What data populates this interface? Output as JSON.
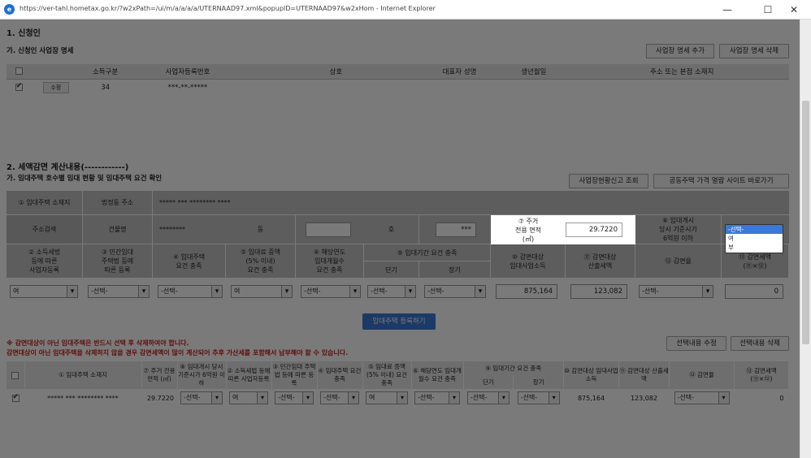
{
  "window": {
    "url": "https://ver-tahl.hometax.go.kr/?w2xPath=/ui/m/a/a/a/a/UTERNAAD97.xml&popupID=UTERNAAD97&w2xHom - Internet Explorer",
    "minimize": "—",
    "maximize": "☐",
    "close": "✕"
  },
  "section1": {
    "title": "1. 신청인",
    "subtitle": "가. 신청인 사업장 명세",
    "add_btn": "사업장 명세 추가",
    "del_btn": "사업장 명세 삭제",
    "columns": [
      "소득구분",
      "사업자등록번호",
      "상호",
      "대표자 성명",
      "생년월일",
      "주소 또는 본점 소재지"
    ],
    "row": {
      "btn": "수정",
      "income": "34",
      "bizno": "***-**-*****"
    }
  },
  "section2": {
    "title": "2. 세액감면 계산내용(------------)",
    "subtitle": "가. 임대주택 호수별 임대 현황 및 임대주택 요건 확인",
    "btn_status": "사업장현황신고 조회",
    "btn_price": "공동주택 가격 열람 사이트 바로가기",
    "grid": {
      "loc_label": "① 임대주택 소재지",
      "legal_dong_label": "법정동 주소",
      "legal_dong_value": "*****  ***  ********  ****",
      "addr_search": "주소검색",
      "bldg_label": "건물명",
      "bldg_value": "********",
      "dong_label": "동",
      "ho_label": "호",
      "ho_value": "***",
      "area_label": [
        "⑦ 주거",
        "전용 면적",
        "(㎡)"
      ],
      "area_value": "29.7220",
      "start_price_label": [
        "⑧ 임대개시",
        "당시 기준시가",
        "6억원 이하"
      ],
      "dropdown_options": [
        "-선택-",
        "여",
        "부"
      ],
      "col_labels": [
        [
          "② 소득세법",
          "등에 따른",
          "사업자등록"
        ],
        [
          "③ 민간임대",
          "주택법 등에",
          "따른 등록"
        ],
        [
          "④ 임대주택",
          "요건 충족"
        ],
        [
          "⑤ 임대료 증액",
          "(5% 이내)",
          "요건 충족"
        ],
        [
          "⑥ 해당연도",
          "임대개월수",
          "요건 충족"
        ],
        [
          "⑨ 임대기간 요건 충족"
        ],
        [
          "⑩ 감면대상",
          "임대사업소득"
        ],
        [
          "⑪ 감면대상",
          "산출세액"
        ],
        [
          "⑫ 감면율"
        ],
        [
          "⑬ 감면세액",
          "(⑪×⑫)"
        ]
      ],
      "short_label": "단기",
      "long_label": "장기",
      "values": {
        "c2": "여",
        "c3": "-선택-",
        "c4": "-선택-",
        "c5": "여",
        "c6": "-선택-",
        "short": "-선택-",
        "long": "-선택-",
        "income": "875,164",
        "tax": "123,082",
        "rate": "-선택-",
        "reduce": "0"
      }
    },
    "register_btn": "임대주택 등록하기",
    "warn1": "※ 감면대상이 아닌 임대주택은 반드시 선택 후 삭제하여야 합니다.",
    "warn2": "  감면대상이 아닌 임대주택을 삭제하지 않을 경우 감면세액이 많이 계산되어 추후 가산세를 포함해서 납부해야 할 수 있습니다.",
    "btn_edit": "선택내용 수정",
    "btn_delete": "선택내용 삭제",
    "table": {
      "headers": {
        "loc": "① 임대주택 소재지",
        "area": "⑦ 주거 전용 면적 (㎡)",
        "price": "⑧ 임대개시 당시 기준시가 6억원 이하",
        "c2": "② 소득세법 등에 따른 사업자등록",
        "c3": "③ 민간임대 주택법 등에 따른 등록",
        "c4": "④ 임대주택 요건 충족",
        "c5": "⑤ 임대료 증액 (5% 이내) 요건 충족",
        "c6": "⑥ 해당연도 임대개월수 요건 충족",
        "period": "⑨ 임대기간 요건 충족",
        "short": "단기",
        "long": "장기",
        "income": "⑩ 감면대상 임대사업소득",
        "tax": "⑪ 감면대상 산출세액",
        "rate": "⑫ 감면율",
        "reduce": "⑬ 감면세액 (⑪×⑫)"
      },
      "row": {
        "loc": "*****  ***  ********  ****",
        "area": "29.7220",
        "price": "-선택-",
        "c2": "여",
        "c3": "-선택-",
        "c4": "-선택-",
        "c5": "여",
        "c6": "-선택-",
        "short": "-선택-",
        "long": "-선택-",
        "income": "875,164",
        "tax": "123,082",
        "rate": "-선택-",
        "reduce": "0"
      }
    }
  }
}
